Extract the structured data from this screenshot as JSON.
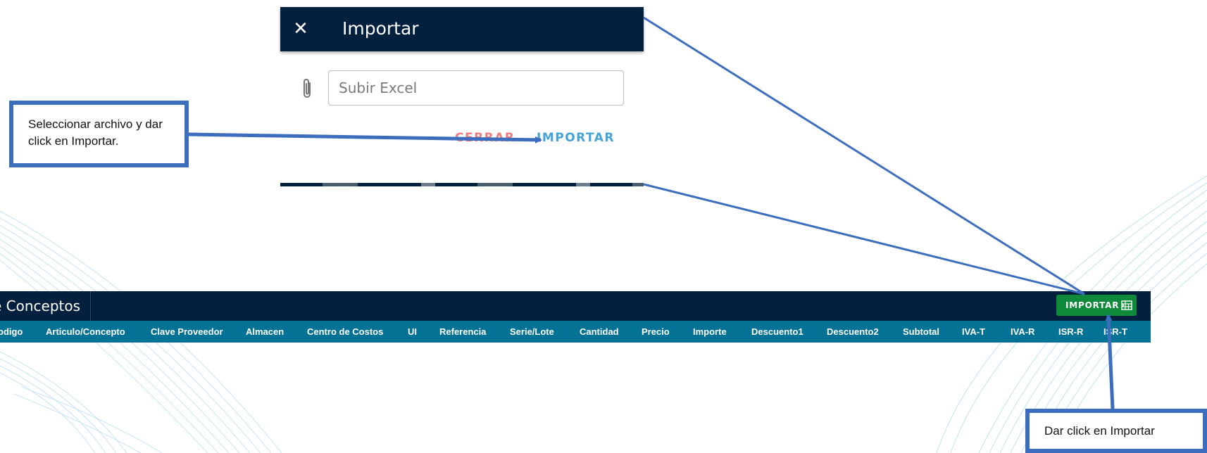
{
  "dialog": {
    "title": "Importar",
    "upload_placeholder": "Subir Excel",
    "close_label": "CERRAR",
    "import_label": "IMPORTAR"
  },
  "section": {
    "title": "e Conceptos",
    "import_button": "IMPORTAR"
  },
  "columns": [
    "odigo",
    "Articulo/Concepto",
    "Clave Proveedor",
    "Almacen",
    "Centro de Costos",
    "UI",
    "Referencia",
    "Serie/Lote",
    "Cantidad",
    "Precio",
    "Importe",
    "Descuento1",
    "Descuento2",
    "Subtotal",
    "IVA-T",
    "IVA-R",
    "ISR-R",
    "ISR-T"
  ],
  "callouts": {
    "select_file": "Seleccionar archivo y dar click en Importar.",
    "click_import": "Dar click en Importar"
  },
  "colors": {
    "header_navy": "#03203f",
    "columns_teal": "#047294",
    "import_green": "#0f8a3a",
    "callout_blue": "#3d6dbd",
    "close_red": "#ef7c7c",
    "import_blue": "#46a3d8"
  },
  "icons": [
    "close-icon",
    "paperclip-icon",
    "excel-icon"
  ]
}
